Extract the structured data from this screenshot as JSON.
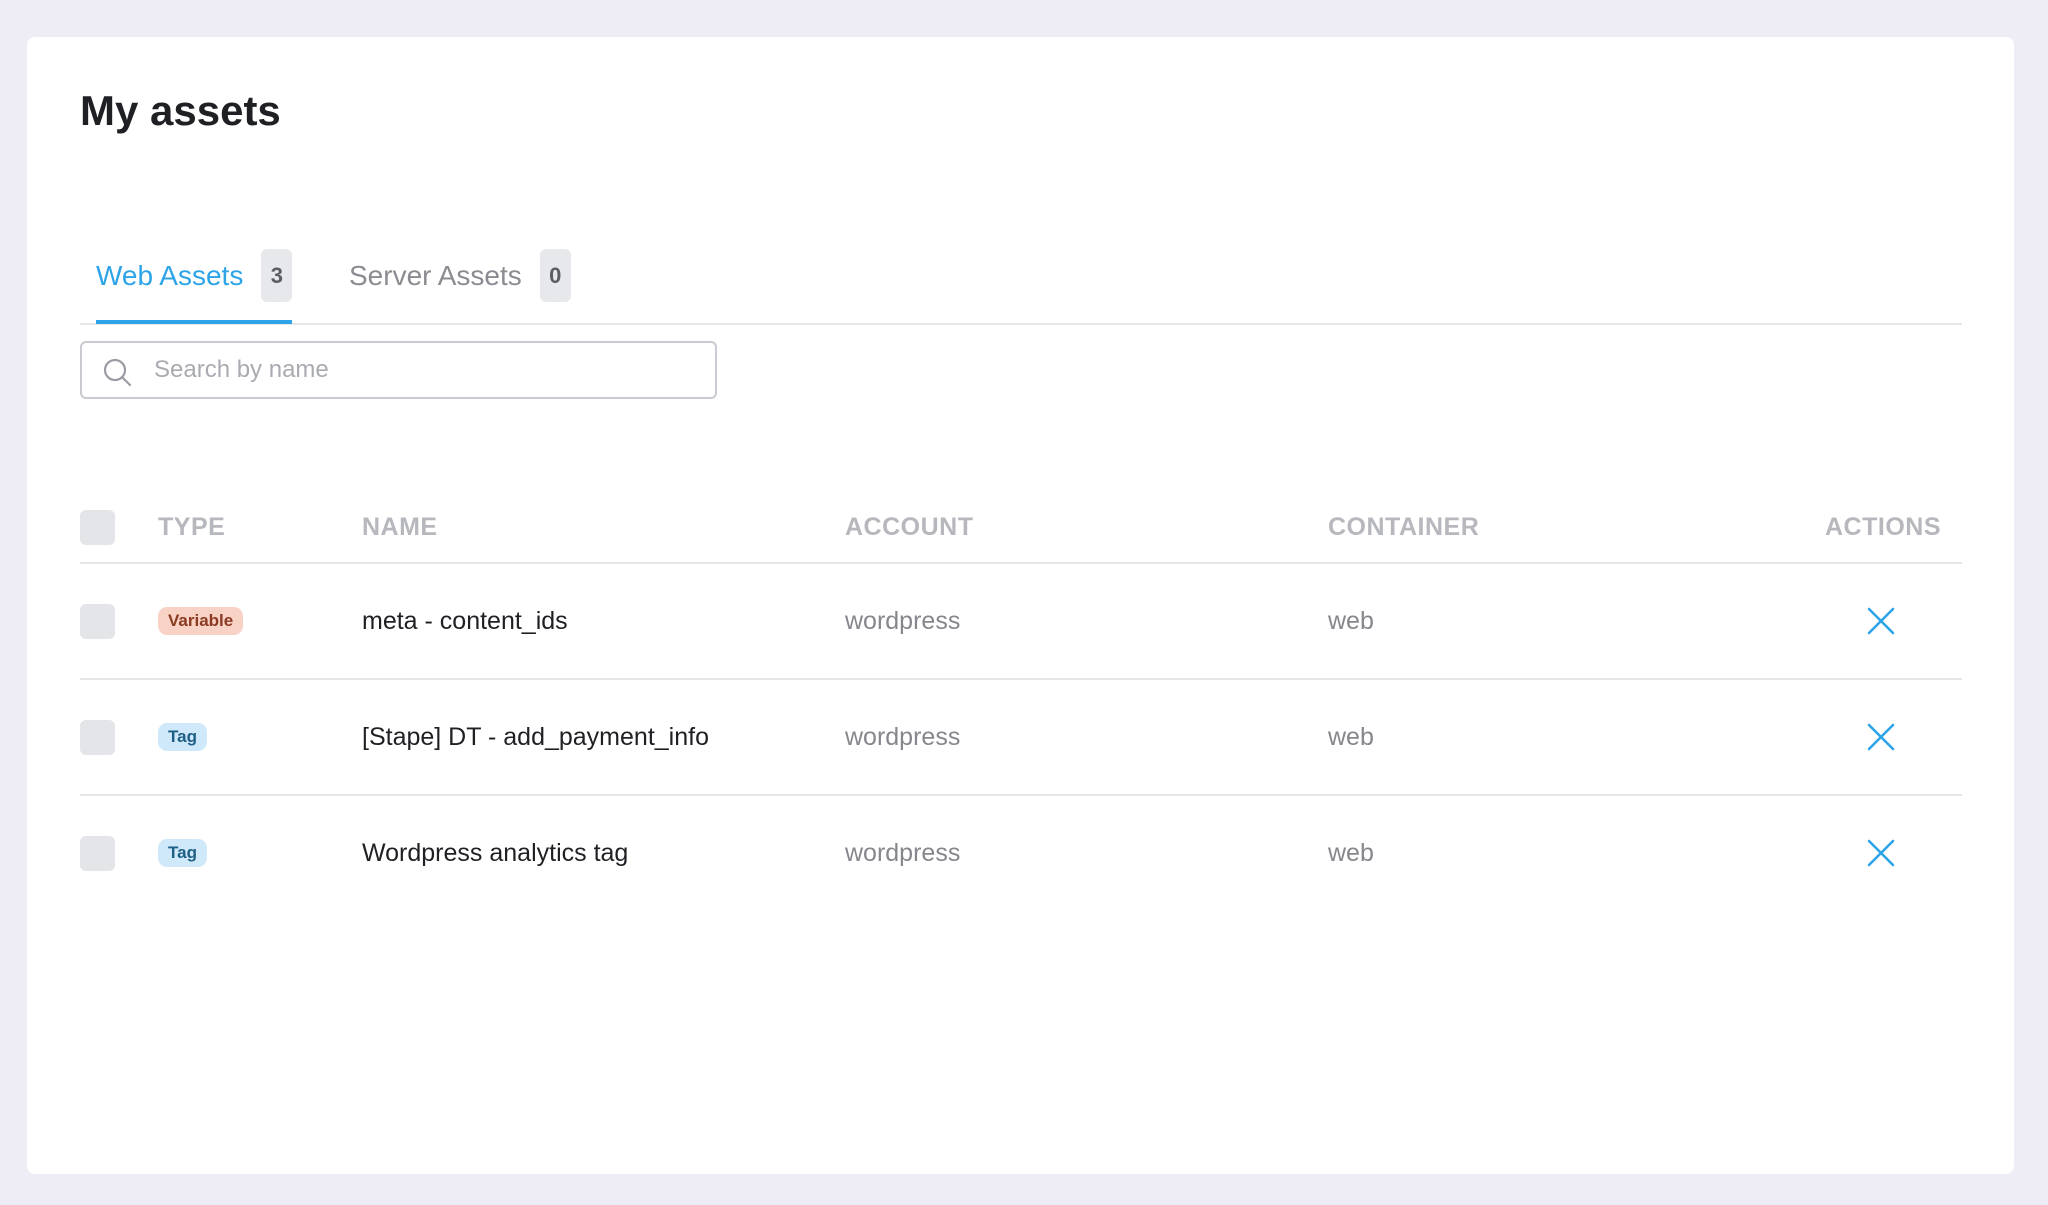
{
  "page": {
    "title": "My assets"
  },
  "tabs": [
    {
      "label": "Web Assets",
      "count": "3",
      "active": true
    },
    {
      "label": "Server Assets",
      "count": "0",
      "active": false
    }
  ],
  "search": {
    "placeholder": "Search by name",
    "value": ""
  },
  "table": {
    "columns": {
      "type": "TYPE",
      "name": "NAME",
      "account": "ACCOUNT",
      "container": "CONTAINER",
      "actions": "ACTIONS"
    },
    "rows": [
      {
        "type": "Variable",
        "name": "meta - content_ids",
        "account": "wordpress",
        "container": "web"
      },
      {
        "type": "Tag",
        "name": "[Stape] DT - add_payment_info",
        "account": "wordpress",
        "container": "web"
      },
      {
        "type": "Tag",
        "name": "Wordpress analytics tag",
        "account": "wordpress",
        "container": "web"
      }
    ]
  },
  "colors": {
    "accent": "#2ea4e8",
    "variable_badge_bg": "#f9d2c6",
    "variable_badge_text": "#8a3b22",
    "tag_badge_bg": "#cfe9fa",
    "tag_badge_text": "#1e5f85"
  },
  "icons": {
    "search": "search-icon",
    "remove": "close-icon"
  }
}
